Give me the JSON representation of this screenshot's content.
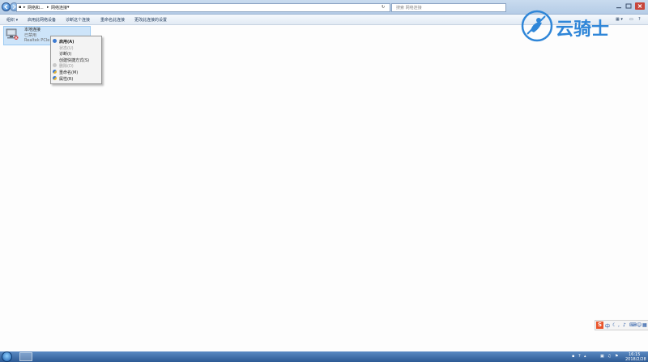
{
  "window": {
    "breadcrumb": [
      "网络和...",
      "网络连接"
    ],
    "search_placeholder": "搜索 网络连接",
    "window_controls": [
      "minimize-icon",
      "maximize-icon",
      "close-icon"
    ]
  },
  "toolbar": {
    "items": [
      "组织 ▾",
      "启用此网络设备",
      "诊断这个连接",
      "重命名此连接",
      "更改此连接的设置"
    ]
  },
  "connection": {
    "name": "本地连接",
    "status": "已禁用",
    "adapter": "Realtek PCIe"
  },
  "context_menu": {
    "items": [
      {
        "label": "启用(A)",
        "bold": true,
        "enabled": true,
        "icon": "shield-icon"
      },
      {
        "label": "状态(U)",
        "bold": false,
        "enabled": false,
        "icon": ""
      },
      {
        "label": "诊断(I)",
        "bold": false,
        "enabled": true,
        "icon": ""
      },
      {
        "label": "创建快捷方式(S)",
        "bold": false,
        "enabled": true,
        "icon": ""
      },
      {
        "label": "删除(D)",
        "bold": false,
        "enabled": false,
        "icon": "shield-icon"
      },
      {
        "label": "重命名(M)",
        "bold": false,
        "enabled": true,
        "icon": "shield-icon"
      },
      {
        "label": "属性(R)",
        "bold": false,
        "enabled": true,
        "icon": "shield-icon"
      }
    ]
  },
  "watermark": {
    "text": "云骑士"
  },
  "ime": {
    "label": "中"
  },
  "taskbar": {
    "time": "16:15",
    "date": "2018/2/28"
  },
  "colors": {
    "accent": "#2f86d8",
    "selection": "#cde4f9",
    "taskbar": "#2d5a94"
  }
}
